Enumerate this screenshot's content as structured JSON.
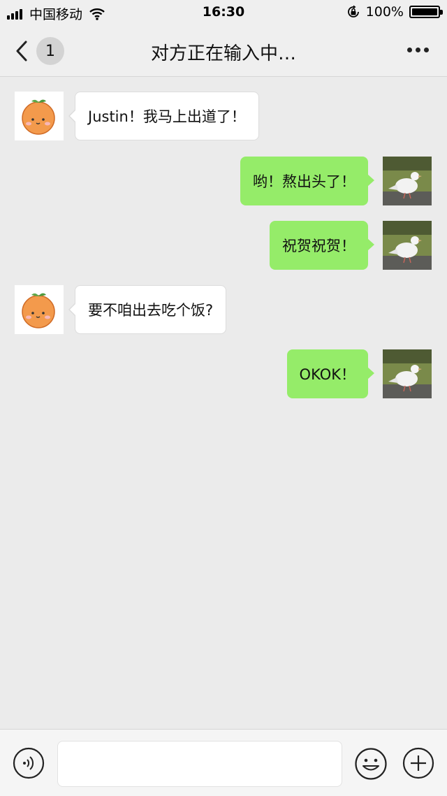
{
  "status_bar": {
    "carrier": "中国移动",
    "time": "16:30",
    "battery": "100%"
  },
  "nav": {
    "back_badge": "1",
    "title": "对方正在输入中…"
  },
  "messages": [
    {
      "side": "in",
      "text": "Justin！我马上出道了！"
    },
    {
      "side": "out",
      "text": "哟！熬出头了！"
    },
    {
      "side": "out",
      "text": "祝贺祝贺！"
    },
    {
      "side": "in",
      "text": "要不咱出去吃个饭?"
    },
    {
      "side": "out",
      "text": "OKOK！"
    }
  ],
  "input": {
    "placeholder": "",
    "value": ""
  },
  "icons": {
    "signal": "signal-bars-icon",
    "wifi": "wifi-icon",
    "lock": "rotation-lock-icon",
    "battery": "battery-icon",
    "back": "chevron-left-icon",
    "more": "more-dots-icon",
    "voice": "voice-icon",
    "emoji": "emoji-icon",
    "plus": "plus-icon",
    "contact_avatar": "orange-avatar",
    "my_avatar": "pigeon-avatar"
  },
  "colors": {
    "chat_background": "#ebebeb",
    "outgoing_bubble": "#95ec69",
    "incoming_bubble": "#ffffff"
  }
}
